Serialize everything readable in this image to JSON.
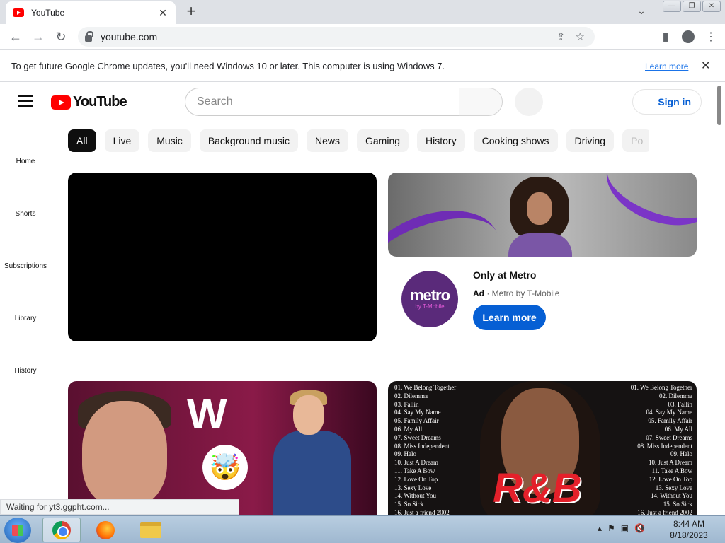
{
  "browser": {
    "tab_title": "YouTube",
    "tab_close": "✕",
    "new_tab": "+",
    "tab_search": "⌄",
    "win_min": "—",
    "win_max": "❐",
    "win_close": "✕",
    "url": "youtube.com",
    "infobar_text": "To get future Google Chrome updates, you'll need Windows 10 or later. This computer is using Windows 7.",
    "infobar_link": "Learn more",
    "infobar_close": "✕",
    "status_text": "Waiting for yt3.ggpht.com..."
  },
  "youtube": {
    "logo_text": "YouTube",
    "search_placeholder": "Search",
    "signin_label": "Sign in",
    "chips": [
      "All",
      "Live",
      "Music",
      "Background music",
      "News",
      "Gaming",
      "History",
      "Cooking shows",
      "Driving",
      "Po"
    ],
    "sidenav": [
      "Home",
      "Shorts",
      "Subscriptions",
      "Library",
      "History"
    ],
    "ad": {
      "logo_main": "metro",
      "logo_sub": "by T-Mobile",
      "title": "Only at Metro",
      "badge": "Ad",
      "advertiser": "Metro by T-Mobile",
      "cta": "Learn more"
    },
    "thumb_left": {
      "letter": "W",
      "emoji": "🤯"
    },
    "thumb_right": {
      "tracks_left": [
        "01. We Belong Together",
        "02. Dilemma",
        "03. Fallin",
        "04. Say My Name",
        "05. Family Affair",
        "06. My All",
        "07. Sweet Dreams",
        "08. Miss Independent",
        "09. Halo",
        "10. Just A Dream",
        "11. Take A Bow",
        "12. Love On Top",
        "13. Sexy Love",
        "14. Without You",
        "15. So Sick",
        "16. Just a friend 2002"
      ],
      "tracks_right": [
        "01. We Belong Together",
        "02. Dilemma",
        "03. Fallin",
        "04. Say My Name",
        "05. Family Affair",
        "06. My All",
        "07. Sweet Dreams",
        "08. Miss Independent",
        "09. Halo",
        "10. Just A Dream",
        "11. Take A Bow",
        "12. Love On Top",
        "13. Sexy Love",
        "14. Without You",
        "15. So Sick",
        "16. Just a friend 2002"
      ],
      "overlay": "R&B"
    }
  },
  "taskbar": {
    "time": "8:44 AM",
    "date": "8/18/2023"
  },
  "colors": {
    "youtube_red": "#ff0000",
    "signin_blue": "#065fd4",
    "metro_purple": "#5a2a7a"
  }
}
